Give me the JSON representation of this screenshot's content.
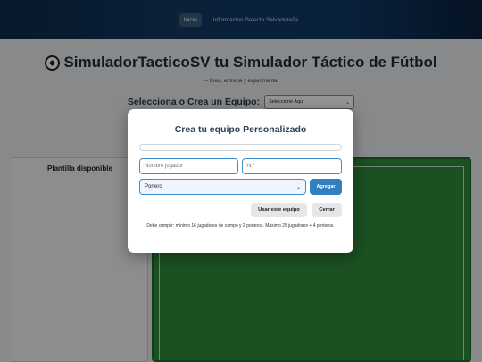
{
  "nav": {
    "items": [
      {
        "label": "Inicio",
        "active": true
      },
      {
        "label": "Informacion Selecta Salvadoreña",
        "active": false
      }
    ]
  },
  "page": {
    "title": "SimuladorTacticoSV tu Simulador Táctico de Fútbol",
    "subtitle": "– Crea, entrena y experimenta",
    "select_label": "Selecciona o Crea un Equipo:",
    "select_value": "Seleccione Aqui",
    "roster_title": "Plantilla disponible"
  },
  "modal": {
    "title": "Crea tu equipo Personalizado",
    "team_name_value": "",
    "player_name_placeholder": "Nombre jugador",
    "number_placeholder": "N.º",
    "position_value": "Portero",
    "add_label": "Agregar",
    "use_team_label": "Usar este equipo",
    "close_label": "Cerrar",
    "rule_text": "Debe cumplir: mínimo 16 jugadores de campo y 2 porteros. Máximo 25 jugadores + 4 porteros."
  },
  "colors": {
    "header": "#123a63",
    "field": "#2e8a3c",
    "primary_button": "#2f7fc1",
    "input_focus": "#3a8fd0"
  },
  "icons": {
    "title_icon": "soccer-ball-icon",
    "dropdown_icon": "chevron-down-icon"
  }
}
